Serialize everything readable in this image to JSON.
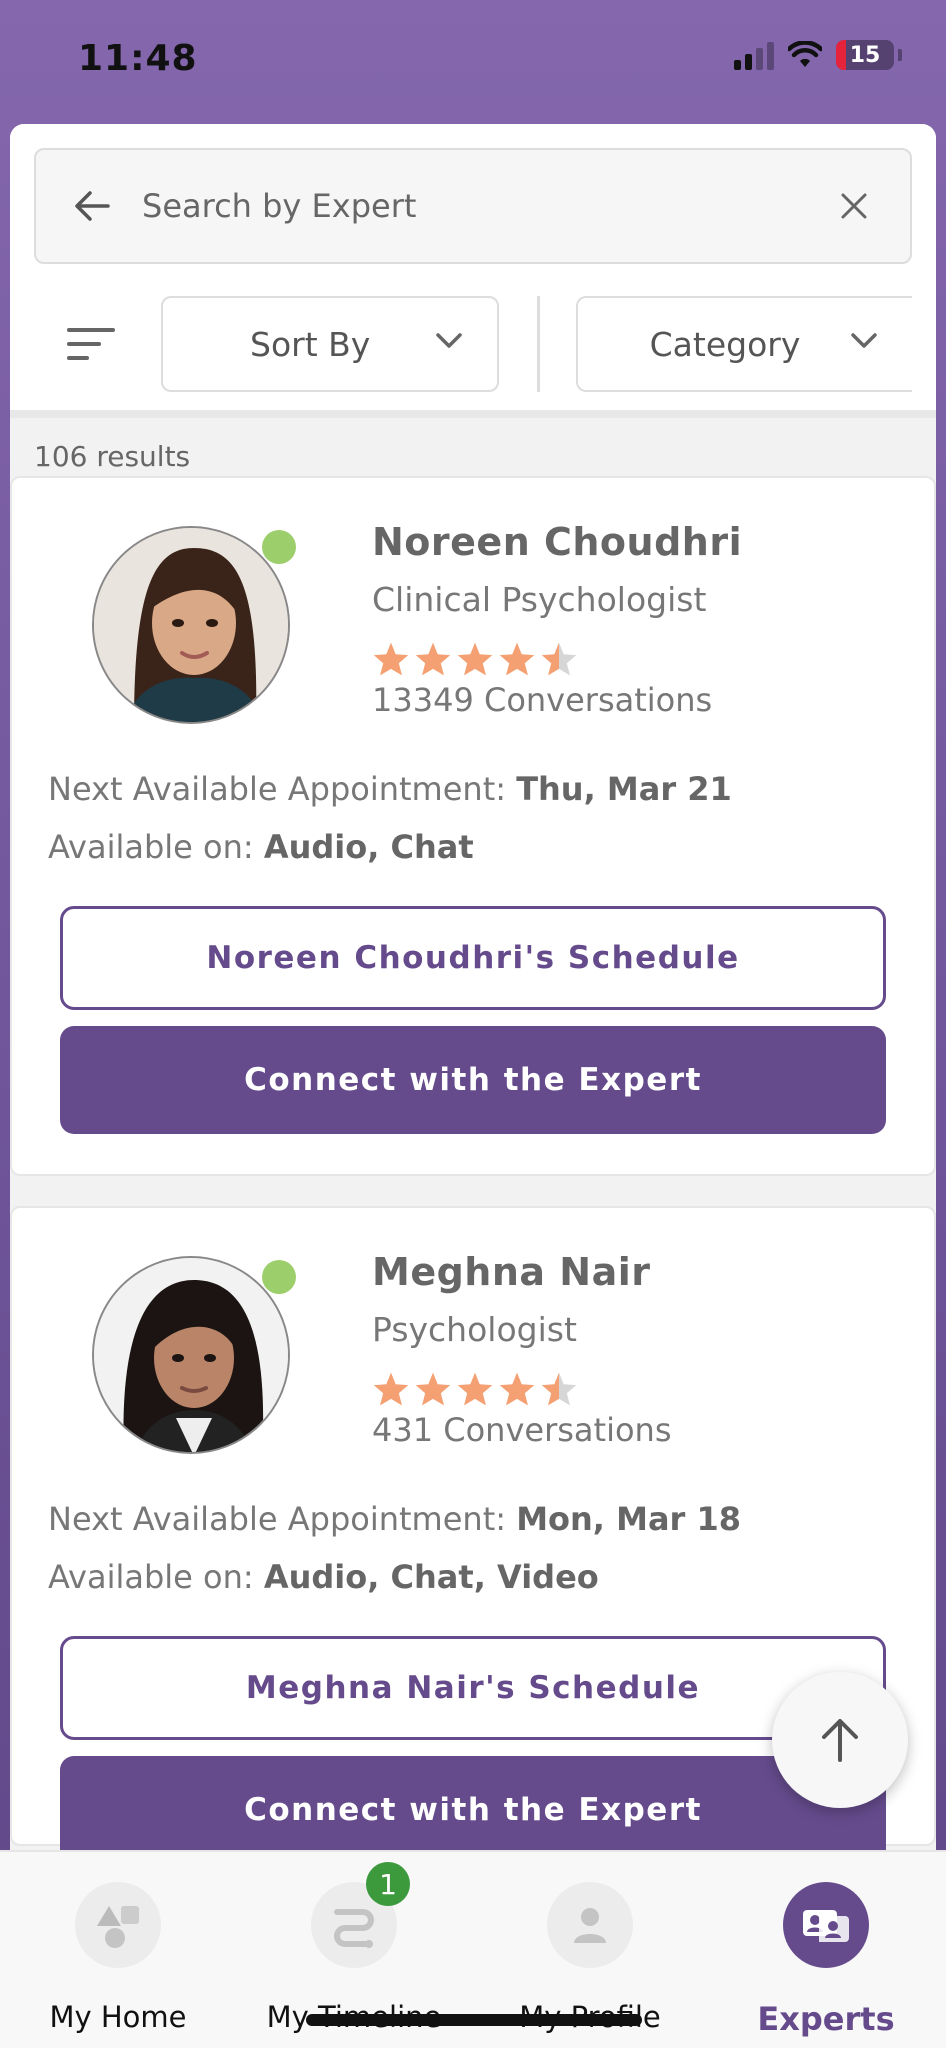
{
  "status_bar": {
    "time": "11:48",
    "battery": "15"
  },
  "search": {
    "placeholder": "Search by Expert"
  },
  "filters": {
    "sort_label": "Sort By",
    "category_label": "Category"
  },
  "results": {
    "count_text": "106 results"
  },
  "experts": [
    {
      "name": "Noreen Choudhri",
      "role": "Clinical Psychologist",
      "rating": 4.5,
      "conversations": "13349 Conversations",
      "next_label": "Next Available Appointment: ",
      "next_value": "Thu, Mar 21",
      "available_label": "Available on: ",
      "available_value": "Audio, Chat",
      "schedule_button": "Noreen Choudhri's Schedule",
      "connect_button": "Connect with the Expert"
    },
    {
      "name": "Meghna Nair",
      "role": "Psychologist",
      "rating": 4.5,
      "conversations": "431 Conversations",
      "next_label": "Next Available Appointment: ",
      "next_value": "Mon, Mar 18",
      "available_label": "Available on: ",
      "available_value": "Audio, Chat, Video",
      "schedule_button": "Meghna Nair's Schedule",
      "connect_button": "Connect with the Expert"
    }
  ],
  "nav": {
    "items": [
      {
        "label": "My Home",
        "icon": "home-shapes-icon"
      },
      {
        "label": "My Timeline",
        "icon": "timeline-icon",
        "badge": "1"
      },
      {
        "label": "My Profile",
        "icon": "profile-icon"
      },
      {
        "label": "Experts",
        "icon": "experts-icon"
      }
    ]
  },
  "colors": {
    "brand": "#654b8c",
    "star": "#f4a072",
    "online": "#9ccf6b",
    "badge": "#3c9a3c"
  }
}
